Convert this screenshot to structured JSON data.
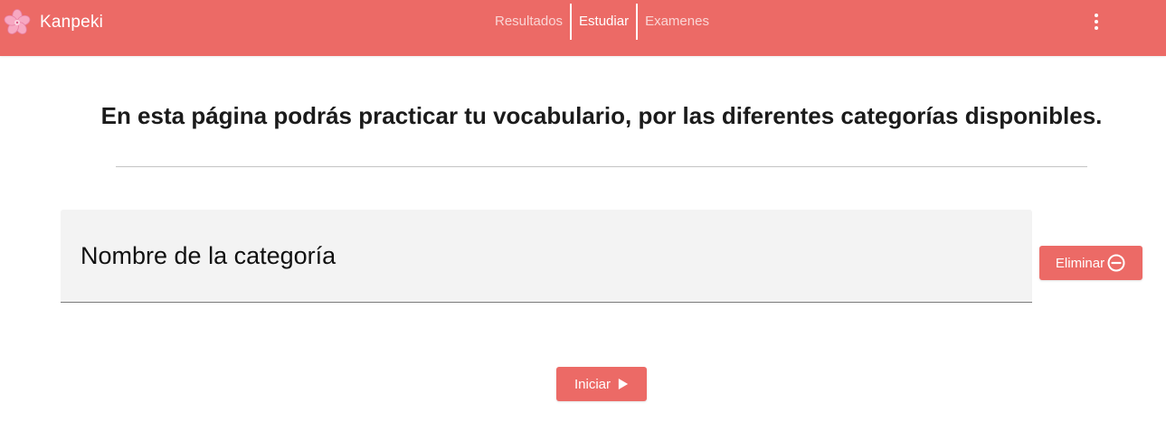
{
  "header": {
    "brand_name": "Kanpeki",
    "logo_icon": "sakura-flower-icon",
    "nav": [
      {
        "label": "Resultados",
        "active": false
      },
      {
        "label": "Estudiar",
        "active": true
      },
      {
        "label": "Examenes",
        "active": false
      }
    ],
    "menu_icon": "more-vertical-icon"
  },
  "main": {
    "headline": "En esta página podrás practicar tu vocabulario, por las diferentes categorías disponibles.",
    "category_field": {
      "value": "Nombre de la categoría"
    },
    "delete_button": {
      "label": "Eliminar",
      "icon": "minus-circle-icon"
    },
    "start_button": {
      "label": "Iniciar",
      "icon": "play-icon"
    }
  },
  "colors": {
    "accent": "#ec6a66",
    "field_background": "#f3f3f3"
  }
}
